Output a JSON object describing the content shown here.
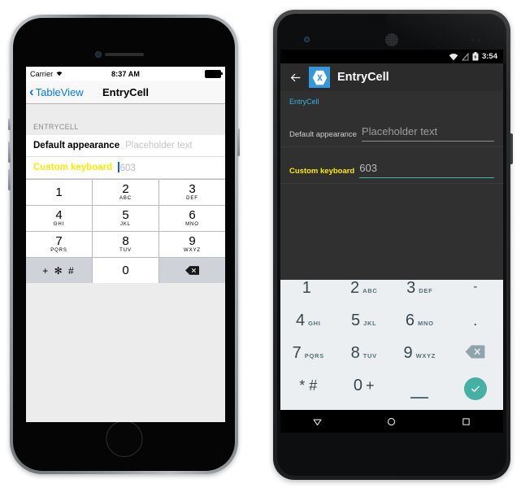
{
  "ios": {
    "status": {
      "carrier": "Carrier",
      "wifi_icon": "wifi-icon",
      "time": "8:37 AM",
      "battery_icon": "battery-icon"
    },
    "nav": {
      "back_label": "TableView",
      "back_icon": "chevron-left-icon",
      "title": "EntryCell"
    },
    "section_header": "ENTRYCELL",
    "rows": [
      {
        "label": "Default appearance",
        "value": "",
        "placeholder": "Placeholder text",
        "focused": false
      },
      {
        "label": "Custom keyboard",
        "value": "603",
        "placeholder": "",
        "focused": true
      }
    ],
    "keypad": {
      "keys": [
        {
          "num": "1",
          "sub": ""
        },
        {
          "num": "2",
          "sub": "ABC"
        },
        {
          "num": "3",
          "sub": "DEF"
        },
        {
          "num": "4",
          "sub": "GHI"
        },
        {
          "num": "5",
          "sub": "JKL"
        },
        {
          "num": "6",
          "sub": "MNO"
        },
        {
          "num": "7",
          "sub": "PQRS"
        },
        {
          "num": "8",
          "sub": "TUV"
        },
        {
          "num": "9",
          "sub": "WXYZ"
        }
      ],
      "symbols_key": "+ ✻ #",
      "zero_key": "0",
      "backspace_icon": "backspace-icon"
    }
  },
  "android": {
    "status": {
      "wifi_icon": "wifi-icon",
      "signal_off_icon": "signal-off-icon",
      "battery_icon": "battery-charging-icon",
      "time": "3:54"
    },
    "appbar": {
      "back_icon": "arrow-left-icon",
      "logo_icon": "xamarin-logo-icon",
      "title": "EntryCell"
    },
    "section_header": "EntryCell",
    "rows": [
      {
        "label": "Default appearance",
        "value": "",
        "placeholder": "Placeholder text",
        "focused": false
      },
      {
        "label": "Custom keyboard",
        "value": "603",
        "placeholder": "",
        "focused": true
      }
    ],
    "keyboard": {
      "row1": [
        {
          "num": "1",
          "sub": ""
        },
        {
          "num": "2",
          "sub": "ABC"
        },
        {
          "num": "3",
          "sub": "DEF"
        },
        {
          "sym": "-"
        }
      ],
      "row2": [
        {
          "num": "4",
          "sub": "GHI"
        },
        {
          "num": "5",
          "sub": "JKL"
        },
        {
          "num": "6",
          "sub": "MNO"
        },
        {
          "sym": "."
        }
      ],
      "row3": [
        {
          "num": "7",
          "sub": "PQRS"
        },
        {
          "num": "8",
          "sub": "TUV"
        },
        {
          "num": "9",
          "sub": "WXYZ"
        },
        {
          "icon": "backspace-icon"
        }
      ],
      "row4": [
        {
          "sym": "* #"
        },
        {
          "num": "0",
          "sym2": "+"
        },
        {
          "icon": "underscore-icon"
        },
        {
          "icon": "check-icon"
        }
      ]
    },
    "navbar": {
      "back_icon": "nav-back-triangle-icon",
      "home_icon": "nav-home-circle-icon",
      "recents_icon": "nav-recents-square-icon"
    }
  },
  "colors": {
    "ios_blue": "#007aff",
    "yellow": "#ffe800",
    "android_cyan": "#33b5e5",
    "teal": "#45b0a4",
    "xamarin_blue": "#3498db"
  }
}
